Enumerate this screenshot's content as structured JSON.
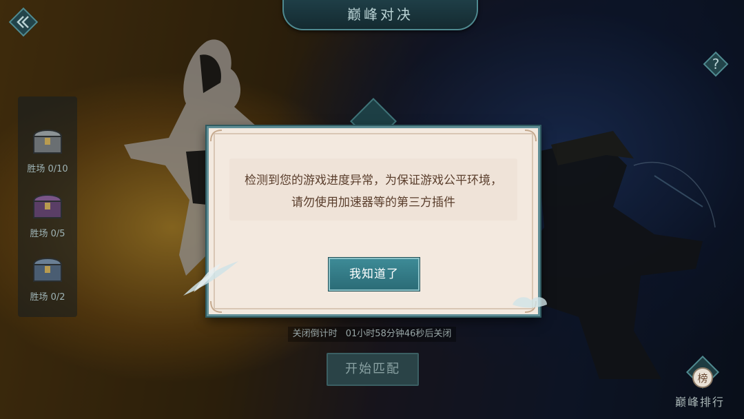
{
  "header": {
    "title": "巅峰对决"
  },
  "rewards": [
    {
      "label": "胜场 0/10",
      "tier": "gold"
    },
    {
      "label": "胜场 0/5",
      "tier": "purple"
    },
    {
      "label": "胜场 0/2",
      "tier": "blue"
    }
  ],
  "dialog": {
    "message": "检测到您的游戏进度异常，为保证游戏公平环境，请勿使用加速器等的第三方插件",
    "confirm_label": "我知道了"
  },
  "countdown": {
    "label": "关闭倒计时",
    "value": "01小时58分钟46秒后关闭"
  },
  "match_button": {
    "label": "开始匹配"
  },
  "rank_button": {
    "label": "巅峰排行",
    "emblem_char": "榜"
  },
  "icons": {
    "back": "double-chevron-left-icon",
    "help": "question-mark-icon",
    "chest": "treasure-chest-icon"
  },
  "colors": {
    "accent": "#2b6c77",
    "dialog_bg": "#f3e9df",
    "dialog_text": "#5a3e2c",
    "frame": "#5f8e96"
  }
}
